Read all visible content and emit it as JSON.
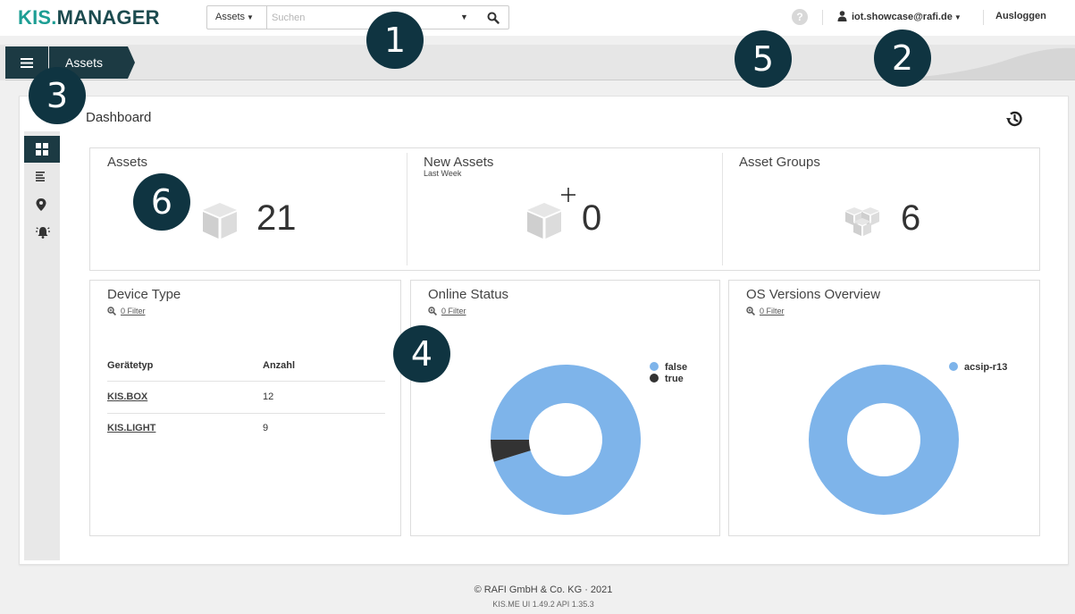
{
  "brand": {
    "part1": "KIS.",
    "part2": "MANAGER"
  },
  "search": {
    "scope": "Assets",
    "placeholder": "Suchen"
  },
  "user": {
    "email": "iot.showcase@rafi.de",
    "logout": "Ausloggen",
    "help": "?"
  },
  "breadcrumb": {
    "current": "Assets"
  },
  "dashboard": {
    "title": "Dashboard"
  },
  "stats": [
    {
      "title": "Assets",
      "subtitle": "",
      "value": "21",
      "icon": "cube-icon"
    },
    {
      "title": "New Assets",
      "subtitle": "Last Week",
      "value": "0",
      "icon": "cube-plus-icon"
    },
    {
      "title": "Asset Groups",
      "subtitle": "",
      "value": "6",
      "icon": "cubes-icon"
    }
  ],
  "device_type": {
    "title": "Device Type",
    "filter": "0 Filter",
    "headers": [
      "Gerätetyp",
      "Anzahl"
    ],
    "rows": [
      {
        "type": "KIS.BOX",
        "count": "12"
      },
      {
        "type": "KIS.LIGHT",
        "count": "9"
      }
    ]
  },
  "online_status": {
    "title": "Online Status",
    "filter": "0 Filter"
  },
  "os_versions": {
    "title": "OS Versions Overview",
    "filter": "0 Filter"
  },
  "chart_data": [
    {
      "type": "pie",
      "chart": "online-status-donut",
      "categories": [
        "false",
        "true"
      ],
      "values": [
        20,
        1
      ],
      "colors": [
        "#7eb4ea",
        "#333333"
      ],
      "legend": "top-right"
    },
    {
      "type": "pie",
      "chart": "os-versions-donut",
      "categories": [
        "acsip-r13"
      ],
      "values": [
        21
      ],
      "colors": [
        "#7eb4ea"
      ],
      "legend": "top-right"
    }
  ],
  "footer": {
    "copyright": "© RAFI GmbH & Co. KG · 2021",
    "version": "KIS.ME UI 1.49.2 API 1.35.3"
  },
  "callouts": [
    "1",
    "2",
    "3",
    "4",
    "5",
    "6"
  ],
  "colors": {
    "brand_teal": "#1d9e94",
    "brand_dark": "#1c4b4f",
    "nav_dark": "#1c3a43",
    "chart_blue": "#7eb4ea",
    "callout": "#0f3441"
  }
}
